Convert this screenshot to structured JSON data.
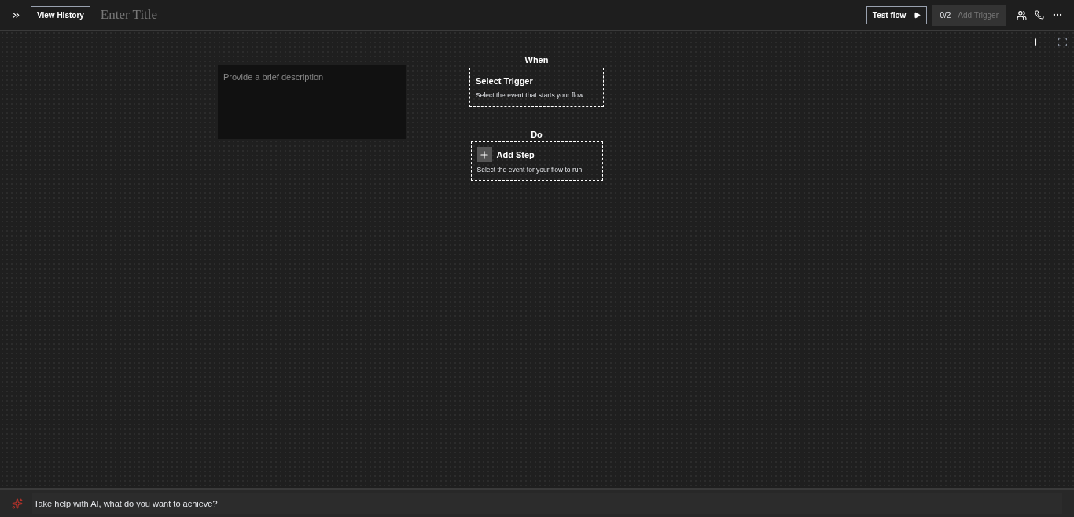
{
  "header": {
    "view_history": "View History",
    "title_placeholder": "Enter Title",
    "test_flow": "Test flow",
    "trigger_count": "0/2",
    "add_trigger": {
      "label": "Add Trigger",
      "disabled": true
    }
  },
  "description": {
    "placeholder": "Provide a brief description"
  },
  "flow": [
    {
      "kind": "trigger",
      "heading": "When",
      "title": "Select Trigger",
      "subtitle": "Select the event that starts your flow"
    },
    {
      "kind": "step",
      "heading": "Do",
      "title": "Add Step",
      "subtitle": "Select the event for your flow to run"
    }
  ],
  "ai_bar": {
    "placeholder": "Take help with AI, what do you want to achieve?"
  }
}
